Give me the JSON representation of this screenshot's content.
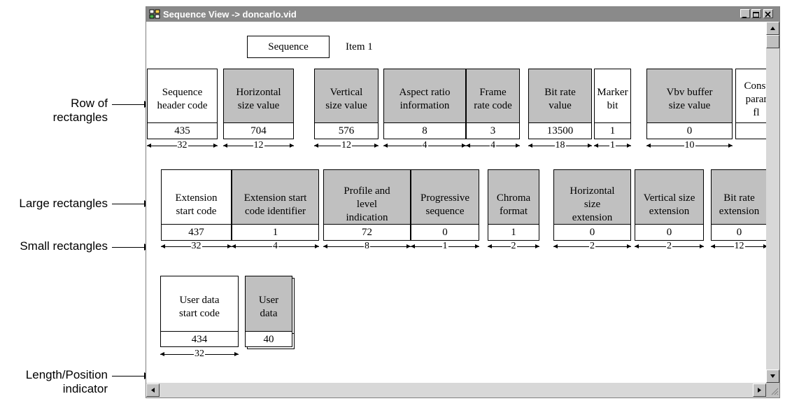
{
  "callouts": {
    "row": "Row of\nrectangles",
    "large": "Large rectangles",
    "small": "Small rectangles",
    "length": "Length/Position\nindicator"
  },
  "window": {
    "title": "Sequence View -> doncarlo.vid"
  },
  "header": {
    "sequence_label": "Sequence",
    "item_label": "Item  1"
  },
  "row1": {
    "fields": [
      {
        "label": "Sequence\nheader code",
        "value": "435",
        "length": "32",
        "shade": "white"
      },
      {
        "label": "Horizontal\nsize value",
        "value": "704",
        "length": "12",
        "shade": "gray"
      },
      {
        "label": "Vertical\nsize value",
        "value": "576",
        "length": "12",
        "shade": "gray"
      },
      {
        "label": "Aspect ratio\ninformation",
        "value": "8",
        "length": "4",
        "shade": "gray"
      },
      {
        "label": "Frame\nrate code",
        "value": "3",
        "length": "4",
        "shade": "gray"
      },
      {
        "label": "Bit rate\nvalue",
        "value": "13500",
        "length": "18",
        "shade": "gray"
      },
      {
        "label": "Marker\nbit",
        "value": "1",
        "length": "1",
        "shade": "white"
      },
      {
        "label": "Vbv buffer\nsize value",
        "value": "0",
        "length": "10",
        "shade": "gray"
      },
      {
        "label": "Const\nparar\nfl",
        "value": "",
        "length": "",
        "shade": "white"
      }
    ]
  },
  "row2": {
    "fields": [
      {
        "label": "Extension\nstart code",
        "value": "437",
        "length": "32",
        "shade": "white"
      },
      {
        "label": "Extension start\ncode identifier",
        "value": "1",
        "length": "4",
        "shade": "gray"
      },
      {
        "label": "Profile and\nlevel\nindication",
        "value": "72",
        "length": "8",
        "shade": "gray"
      },
      {
        "label": "Progressive\nsequence",
        "value": "0",
        "length": "1",
        "shade": "gray"
      },
      {
        "label": "Chroma\nformat",
        "value": "1",
        "length": "2",
        "shade": "gray"
      },
      {
        "label": "Horizontal\nsize\nextension",
        "value": "0",
        "length": "2",
        "shade": "gray"
      },
      {
        "label": "Vertical size\nextension",
        "value": "0",
        "length": "2",
        "shade": "gray"
      },
      {
        "label": "Bit rate\nextension",
        "value": "0",
        "length": "12",
        "shade": "gray"
      }
    ]
  },
  "row3": {
    "fields": [
      {
        "label": "User data\nstart code",
        "value": "434",
        "length": "32",
        "shade": "white"
      },
      {
        "label": "User\ndata",
        "value": "40",
        "length": "",
        "shade": "gray"
      }
    ]
  }
}
